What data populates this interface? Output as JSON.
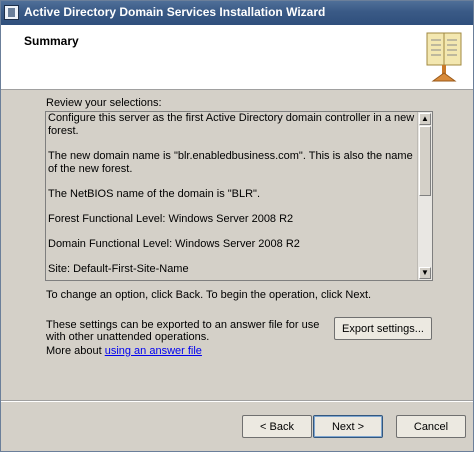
{
  "window": {
    "title": "Active Directory Domain Services Installation Wizard"
  },
  "header": {
    "title": "Summary",
    "icon": "book-icon"
  },
  "review": {
    "label": "Review your selections:",
    "lines": [
      "Configure this server as the first Active Directory domain controller in a new forest.",
      "The new domain name is \"blr.enabledbusiness.com\". This is also the name of the new forest.",
      "The NetBIOS name of the domain is \"BLR\".",
      "Forest Functional Level: Windows Server 2008 R2",
      "Domain Functional Level: Windows Server 2008 R2",
      "Site: Default-First-Site-Name"
    ]
  },
  "notes": {
    "change": "To change an option, click Back. To begin the operation, click Next.",
    "export": "These settings can be exported to an answer file for use with other unattended operations.",
    "more_prefix": "More about ",
    "more_link": "using an answer file"
  },
  "buttons": {
    "export": "Export settings...",
    "back": "< Back",
    "next": "Next >",
    "cancel": "Cancel"
  }
}
